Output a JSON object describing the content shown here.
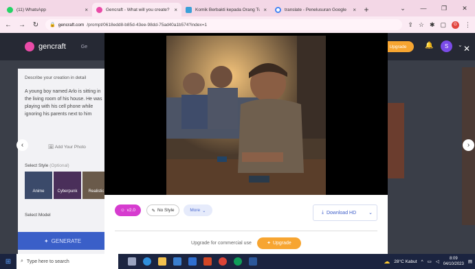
{
  "browser": {
    "tabs": [
      {
        "label": "(11) WhatsApp",
        "color": "#25d366"
      },
      {
        "label": "Gencraft - What will you create?",
        "color": "#e94ba7"
      },
      {
        "label": "Komik Berbakti kepada Orang Tua",
        "color": "#3aa0d8"
      },
      {
        "label": "translate - Penelusuran Google",
        "color": "#4285f4"
      }
    ],
    "url_host": "gencraft.com",
    "url_path": "/prompt/0618edd8-b85d-43ee-98dd-75ad40a1b574?index=1"
  },
  "app": {
    "logo": "gencraft",
    "nav": "Ge",
    "header_upgrade": "Upgrade",
    "avatar_letter": "S",
    "describe_label": "Describe your creation in detail",
    "prompt_text": "A young boy named Arlo is sitting in the living room of his house. He was playing with his cell phone while ignoring his parents next to him",
    "add_photo": "Add Your Photo",
    "select_style": "Select Style",
    "select_style_hint": "(Optional)",
    "styles": [
      "Anime",
      "Cyberpunk",
      "Realistic"
    ],
    "select_model": "Select Model",
    "generate": "GENERATE"
  },
  "modal": {
    "version_label": "v2.0",
    "nostyle_label": "No Style",
    "more_label": "More",
    "download_label": "Download HD",
    "upgrade_text": "Upgrade for commercial use",
    "upgrade_button": "Upgrade"
  },
  "taskbar": {
    "search_placeholder": "Type here to search",
    "weather": "28°C  Kabut",
    "time": "8:09",
    "date": "04/10/2023"
  },
  "colors": {
    "accent_pink": "#d63ccf",
    "upgrade_orange": "#f7a531",
    "link_blue": "#3c5cc8"
  }
}
